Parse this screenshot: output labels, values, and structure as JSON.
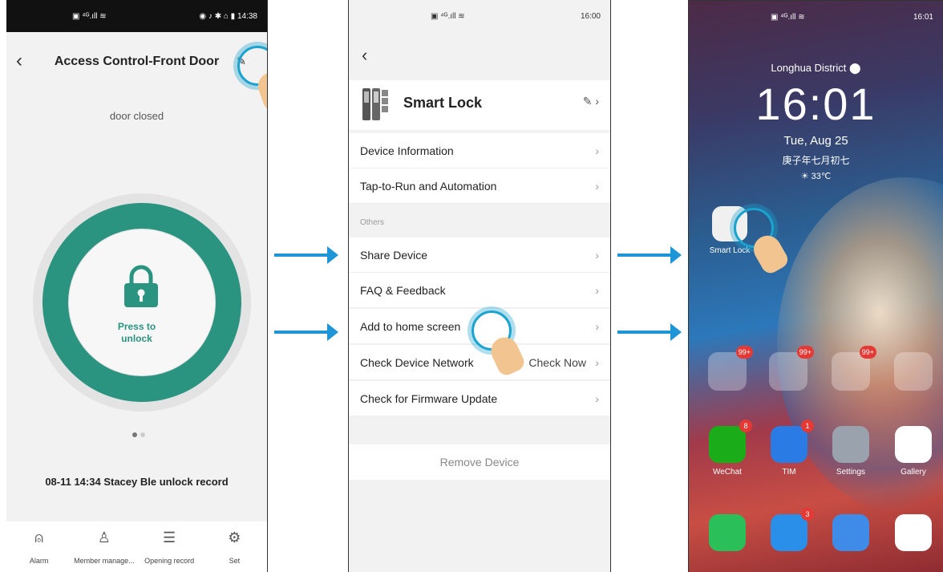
{
  "phone1": {
    "status": {
      "time": "14:38",
      "icons": "◉ ♪ ✱ ⌂ ▮"
    },
    "header": {
      "title": "Access Control-Front Door"
    },
    "door_status": "door closed",
    "button_label_1": "Press to",
    "button_label_2": "unlock",
    "record": "08-11 14:34 Stacey Ble unlock record",
    "tabs": [
      {
        "label": "Alarm",
        "icon": "alarm-icon"
      },
      {
        "label": "Member manage...",
        "icon": "person-icon"
      },
      {
        "label": "Opening record",
        "icon": "list-icon"
      },
      {
        "label": "Set",
        "icon": "gear-icon"
      }
    ],
    "colors": {
      "accent": "#2a9480"
    }
  },
  "phone2": {
    "status": {
      "time": "16:00"
    },
    "device_name": "Smart Lock",
    "menu": [
      {
        "label": "Device Information"
      },
      {
        "label": "Tap-to-Run and Automation"
      }
    ],
    "section_label": "Others",
    "others": [
      {
        "label": "Share Device"
      },
      {
        "label": "FAQ & Feedback"
      },
      {
        "label": "Add to home screen"
      },
      {
        "label": "Check Device Network",
        "extra": "Check Now"
      },
      {
        "label": "Check for Firmware Update"
      }
    ],
    "remove_label": "Remove Device"
  },
  "phone3": {
    "status": {
      "time": "16:01"
    },
    "district": "Longhua District",
    "clock": "16:01",
    "date": "Tue, Aug 25",
    "lunar": "庚子年七月初七",
    "temperature": "33℃",
    "shortcut_label": "Smart Lock",
    "folder_badges": [
      "99+",
      "99+",
      "99+"
    ],
    "apps": [
      {
        "label": "WeChat",
        "badge": "8",
        "color": "#1aad19"
      },
      {
        "label": "TIM",
        "badge": "1",
        "color": "#2a7be4"
      },
      {
        "label": "Settings",
        "badge": "",
        "color": "#9aa3ad"
      },
      {
        "label": "Gallery",
        "badge": "",
        "color": "#ffffff"
      }
    ],
    "dock": [
      {
        "name": "phone",
        "badge": "",
        "color": "#2bbf59"
      },
      {
        "name": "messages",
        "badge": "3",
        "color": "#2a8fe8"
      },
      {
        "name": "browser",
        "badge": "",
        "color": "#3f8ce8"
      },
      {
        "name": "camera",
        "badge": "",
        "color": "#ffffff"
      }
    ]
  }
}
